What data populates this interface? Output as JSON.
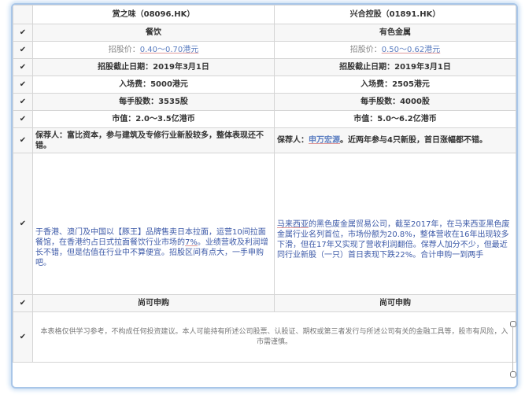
{
  "header": {
    "left": "赏之味（08096.HK）",
    "right": "兴合控股（01891.HK）"
  },
  "rows": {
    "industry": {
      "left": "餐饮",
      "right": "有色金属"
    },
    "price": {
      "label": "招股价：",
      "left": "0.40～0.70港元",
      "right": "0.50～0.62港元"
    },
    "deadline": {
      "left": "招股截止日期：2019年3月1日",
      "right": "招股截止日期：2019年3月1日"
    },
    "entry": {
      "left": "入场费：5000港元",
      "right": "入场费：2505港元"
    },
    "lot": {
      "left": "每手股数：3535股",
      "right": "每手股数：4000股"
    },
    "cap": {
      "left": "市值：2.0～3.5亿港币",
      "right": "市值：5.0～6.2亿港币"
    },
    "sponsor": {
      "left": "保荐人：富比资本，参与建筑及专修行业新股较多，整体表现还不错。",
      "right_prefix": "保荐人：",
      "right_name": "申万宏源",
      "right_suffix": "。近两年参与4只新股，首日涨幅都不错。"
    },
    "business": {
      "left_a": "于香港、澳门及中国以【豚王】品牌售卖日本拉面，运营10间拉面餐馆，在香港约占日式拉面餐饮行业市场的",
      "left_pct": "7%",
      "left_b": "。业绩营收及利润增长不错，但是估值在行业中不算便宜。招股区间有点大，一手申购吧。",
      "right_a": "马来西亚",
      "right_b": "的黑色废金属贸易公司，截至2017年，在马来西亚黑色废金属行业名列首位，市场份额为20.8%，整体营收在16年出现较多下滑，但在17年又实现了营收利润翻倍。保荐人加分不少，但最近同行业新股（一只）首日表现下跌22%。合计申购一到两手"
    },
    "verdict": {
      "left": "尚可申购",
      "right": "尚可申购"
    },
    "disclaimer": "本表格仅供学习参考，不构成任何投资建议。本人可能持有所述公司股票、认股证、期权或第三者发行与所述公司有关的金融工具等，股市有风险，入市需谨慎。"
  },
  "icons": {
    "check": "✔"
  }
}
